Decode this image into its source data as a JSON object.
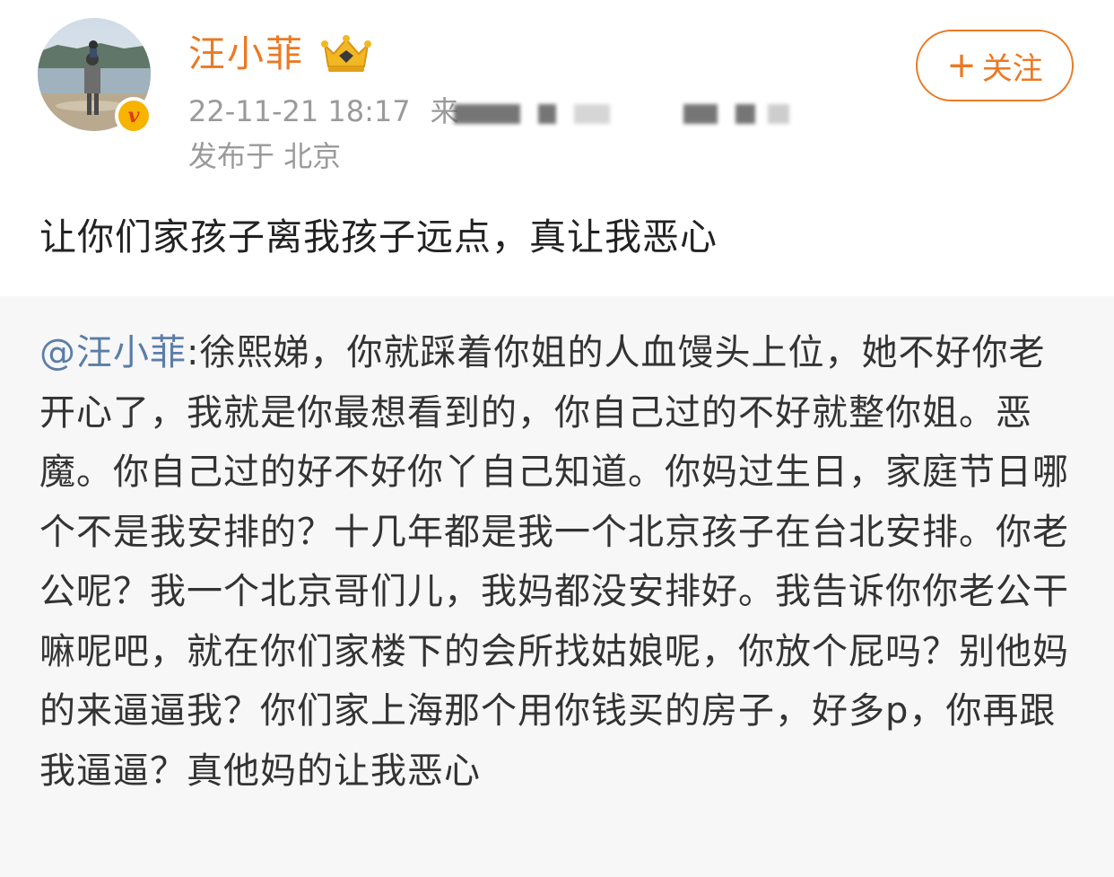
{
  "post": {
    "author": {
      "name": "汪小菲",
      "avatar_icon": "avatar-photo",
      "verified_icon": "verified-v-icon",
      "verified_glyph": "v",
      "vip_icon": "vip-crown-icon"
    },
    "follow_button": {
      "plus": "+",
      "label": "关注"
    },
    "timestamp": "22-11-21 18:17",
    "source_prefix": "来",
    "location": "发布于 北京",
    "text": "让你们家孩子离我孩子远点，真让我恶心"
  },
  "repost": {
    "mention": "@汪小菲",
    "text": ":徐熙娣，你就踩着你姐的人血馒头上位，她不好你老开心了，我就是你最想看到的，你自己过的不好就整你姐。恶魔。你自己过的好不好你丫自己知道。你妈过生日，家庭节日哪个不是我安排的？十几年都是我一个北京孩子在台北安排。你老公呢？我一个北京哥们儿，我妈都没安排好。我告诉你你老公干嘛呢吧，就在你们家楼下的会所找姑娘呢，你放个屁吗？别他妈的来逼逼我？你们家上海那个用你钱买的房子，好多p，你再跟我逼逼？真他妈的让我恶心"
  },
  "colors": {
    "accent": "#ea7a24",
    "mention": "#5b7ea7",
    "meta": "#9a9a9a",
    "repost_bg": "#f7f7f7"
  }
}
